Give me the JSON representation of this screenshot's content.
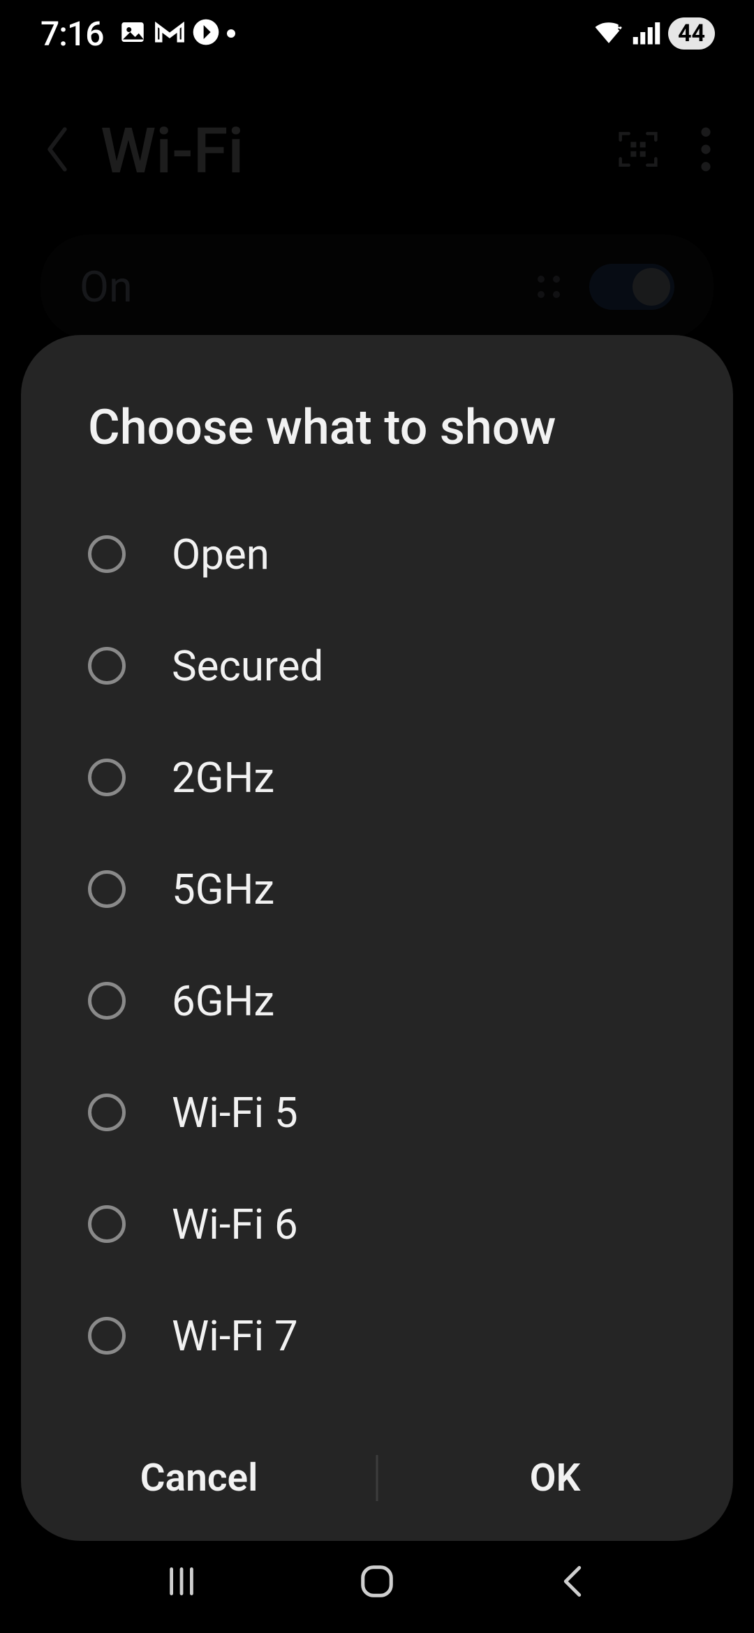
{
  "statusbar": {
    "time": "7:16",
    "battery": "44"
  },
  "page": {
    "title": "Wi-Fi",
    "toggle_label": "On"
  },
  "dialog": {
    "title": "Choose what to show",
    "options": [
      {
        "label": "Open"
      },
      {
        "label": "Secured"
      },
      {
        "label": "2GHz"
      },
      {
        "label": "5GHz"
      },
      {
        "label": "6GHz"
      },
      {
        "label": "Wi-Fi 5"
      },
      {
        "label": "Wi-Fi 6"
      },
      {
        "label": "Wi-Fi 7"
      }
    ],
    "cancel_label": "Cancel",
    "ok_label": "OK"
  }
}
